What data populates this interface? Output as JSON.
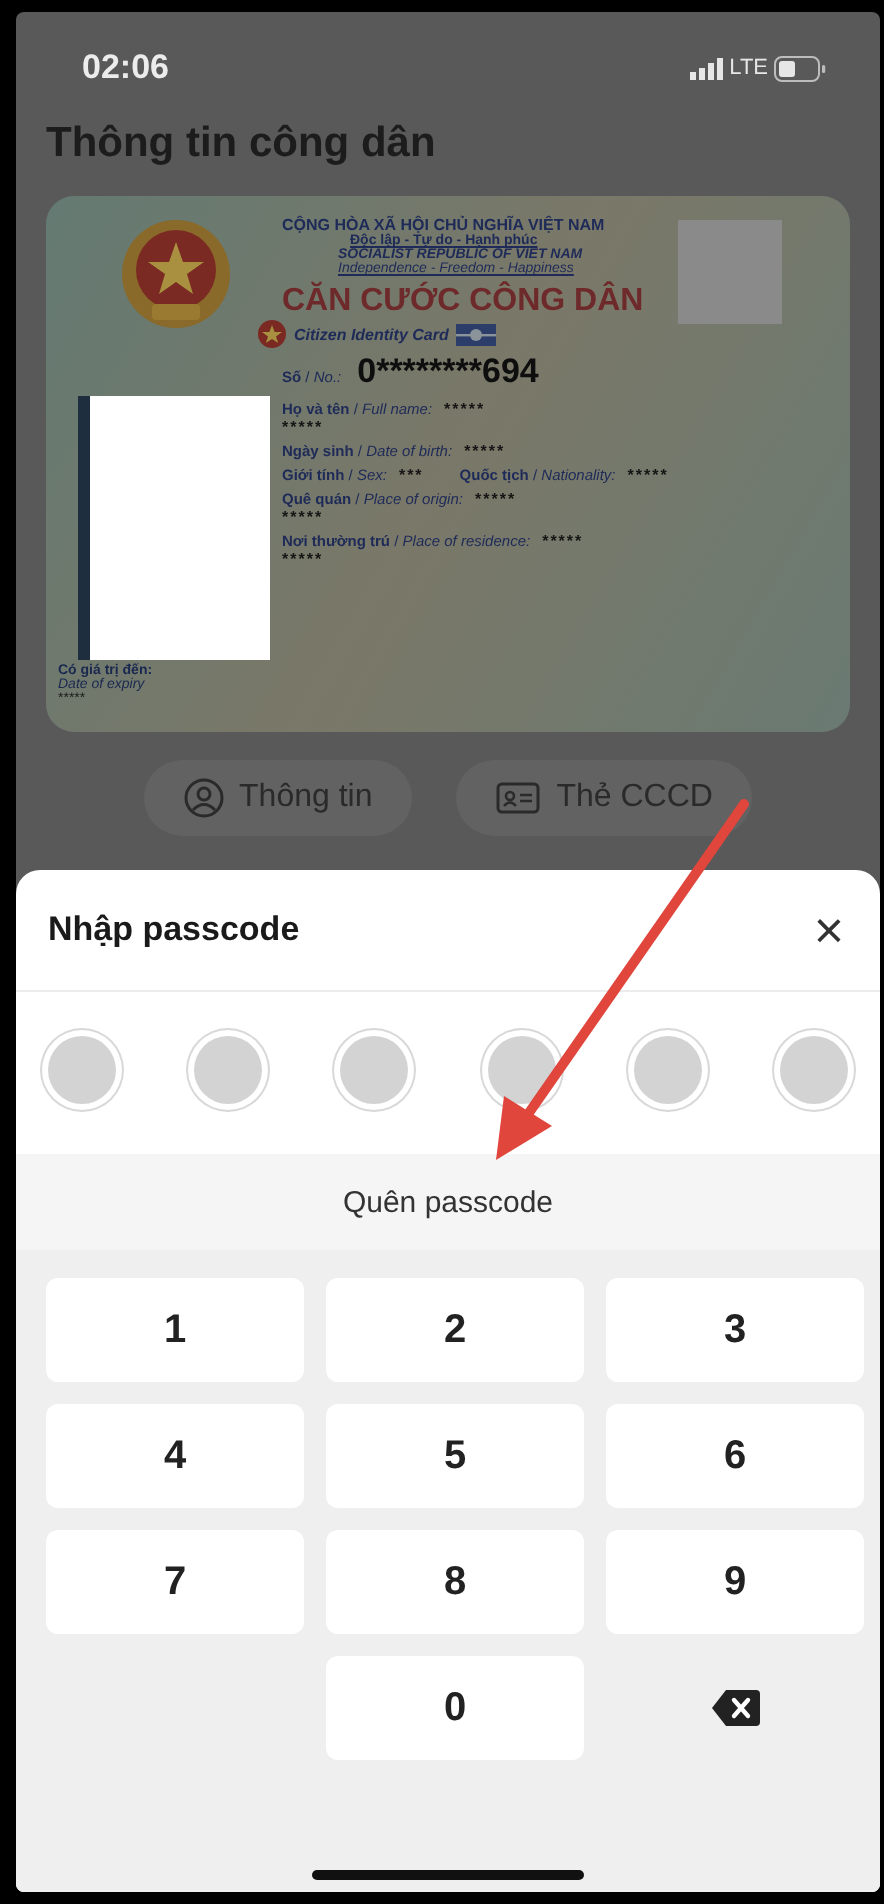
{
  "status_bar": {
    "time": "02:06",
    "network": "LTE"
  },
  "title": "Thông tin công dân",
  "card": {
    "country": "CỘNG HÒA XÃ HỘI CHỦ NGHĨA VIỆT NAM",
    "motto": "Độc lập - Tự do - Hạnh phúc",
    "country_en": "SOCIALIST REPUBLIC OF VIET NAM",
    "motto_en": "Independence - Freedom - Happiness",
    "heading": "CĂN CƯỚC CÔNG DÂN",
    "heading_en": "Citizen Identity Card",
    "number_label": "**Số** / *No.:*",
    "number": "0********694",
    "rows": [
      {
        "parts": [
          {
            "label": "**Họ và tên** / *Full name:*",
            "value": "*****"
          }
        ],
        "continuation": "*****"
      },
      {
        "parts": [
          {
            "label": "**Ngày sinh** / *Date of birth:*",
            "value": "*****"
          }
        ]
      },
      {
        "parts": [
          {
            "label": "**Giới tính** / *Sex:*",
            "value": "***"
          },
          {
            "label": "**Quốc tịch** / *Nationality:*",
            "value": "*****"
          }
        ]
      },
      {
        "parts": [
          {
            "label": "**Quê quán** / *Place of origin:*",
            "value": "*****"
          }
        ],
        "continuation": "*****"
      },
      {
        "parts": [
          {
            "label": "**Nơi thường trú** / *Place of residence:*",
            "value": "*****"
          }
        ],
        "continuation": "*****"
      }
    ],
    "expiry_label": "Có giá trị đến:",
    "expiry_label_en": "Date of expiry",
    "expiry": "*****"
  },
  "tabs": [
    {
      "label": "Thông tin",
      "kind": "person"
    },
    {
      "label": "Thẻ CCCD",
      "kind": "card"
    }
  ],
  "sheet": {
    "title": "Nhập passcode",
    "close": "×",
    "dots": [
      {
        "filled": false
      },
      {
        "filled": false
      },
      {
        "filled": false
      },
      {
        "filled": false
      },
      {
        "filled": false
      },
      {
        "filled": false
      }
    ],
    "forgot": "Quên passcode",
    "keys": [
      {
        "kind": "digit",
        "label": "1"
      },
      {
        "kind": "digit",
        "label": "2"
      },
      {
        "kind": "digit",
        "label": "3"
      },
      {
        "kind": "digit",
        "label": "4"
      },
      {
        "kind": "digit",
        "label": "5"
      },
      {
        "kind": "digit",
        "label": "6"
      },
      {
        "kind": "digit",
        "label": "7"
      },
      {
        "kind": "digit",
        "label": "8"
      },
      {
        "kind": "digit",
        "label": "9"
      },
      {
        "kind": "empty"
      },
      {
        "kind": "digit",
        "label": "0"
      },
      {
        "kind": "backspace"
      }
    ]
  }
}
